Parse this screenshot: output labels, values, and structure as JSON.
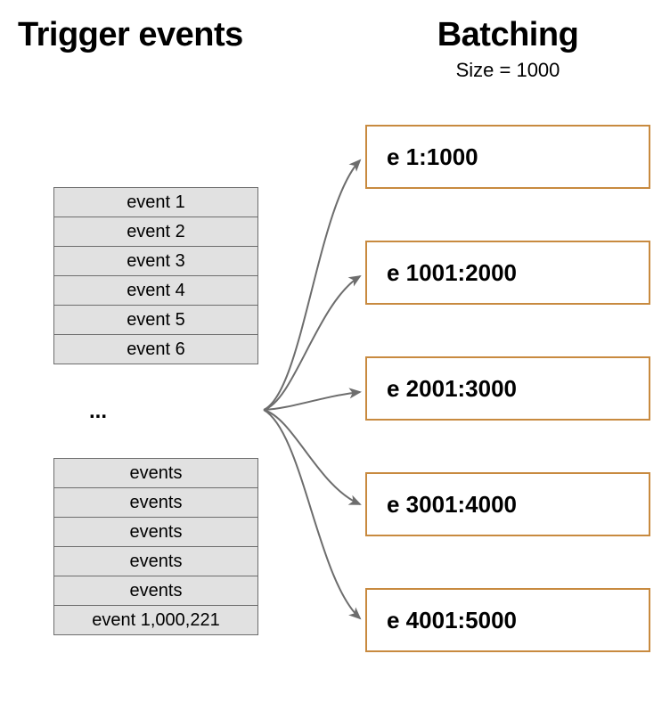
{
  "left": {
    "title": "Trigger events",
    "stack_top": [
      "event 1",
      "event 2",
      "event 3",
      "event 4",
      "event 5",
      "event 6"
    ],
    "ellipsis": "...",
    "stack_bottom": [
      "events",
      "events",
      "events",
      "events",
      "events",
      "event 1,000,221"
    ]
  },
  "right": {
    "title": "Batching",
    "size_label": "Size = 1000",
    "batches": [
      "e 1:1000",
      "e 1001:2000",
      "e 2001:3000",
      "e 3001:4000",
      "e 4001:5000"
    ]
  },
  "chart_data": {
    "type": "table",
    "description": "A stream of trigger events (event 1 through event 1,000,221) is partitioned into batches of size 1000.",
    "batch_size": 1000,
    "total_events": 1000221,
    "batches_shown": [
      {
        "label": "e 1:1000",
        "start": 1,
        "end": 1000
      },
      {
        "label": "e 1001:2000",
        "start": 1001,
        "end": 2000
      },
      {
        "label": "e 2001:3000",
        "start": 2001,
        "end": 3000
      },
      {
        "label": "e 3001:4000",
        "start": 3001,
        "end": 4000
      },
      {
        "label": "e 4001:5000",
        "start": 4001,
        "end": 5000
      }
    ]
  }
}
